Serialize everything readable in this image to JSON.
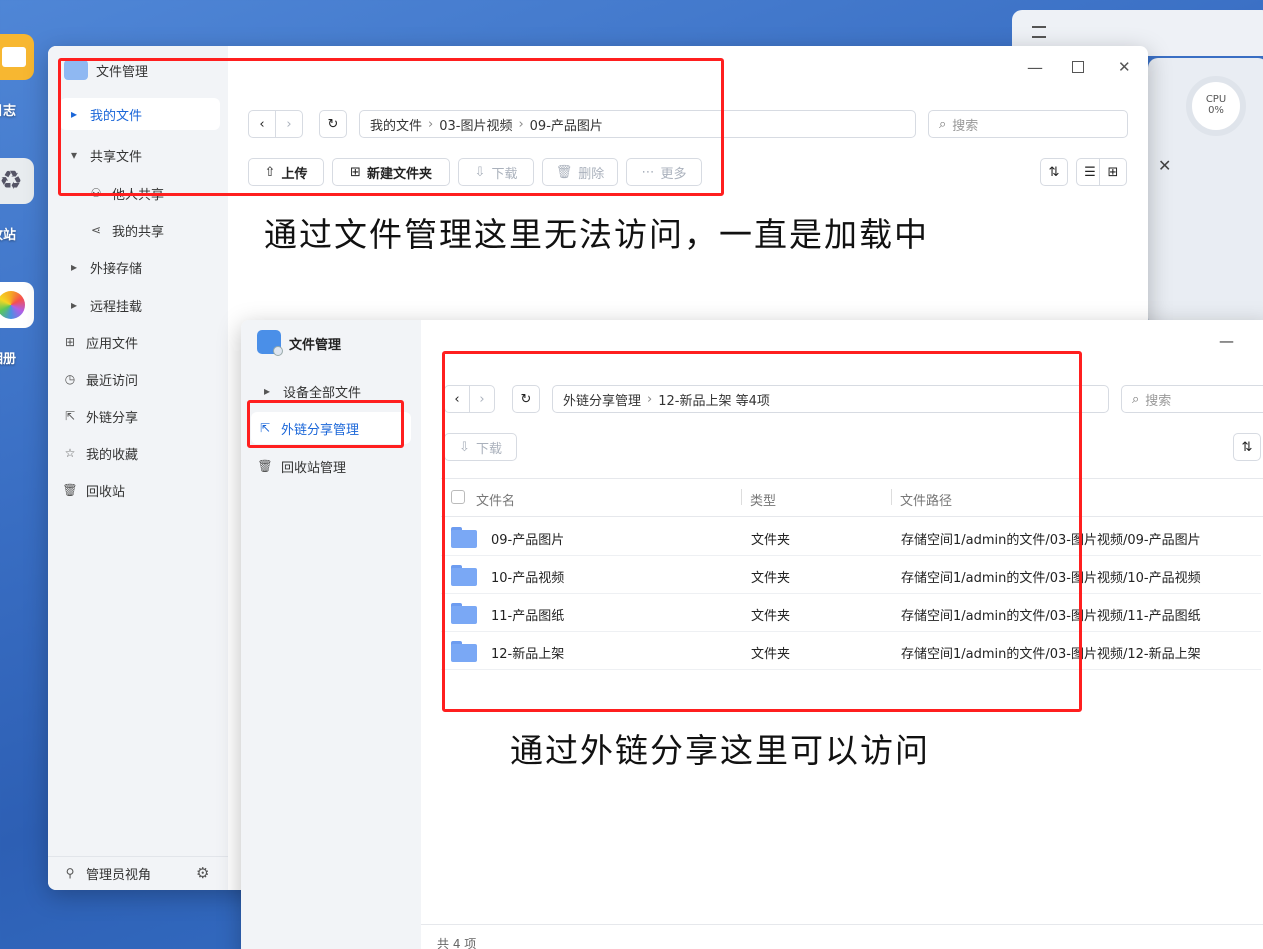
{
  "desktop": {
    "icons": [
      {
        "label": "日志",
        "icon": "log-icon"
      },
      {
        "label": "收站",
        "icon": "recycle-icon"
      },
      {
        "label": "相册",
        "icon": "photos-icon"
      }
    ],
    "widget": {
      "cpu_label": "CPU",
      "cpu_value": "0%"
    }
  },
  "back_window": {
    "title": "文件管理",
    "sidebar": {
      "items": [
        {
          "label": "我的文件",
          "icon": "triangle-right-icon"
        },
        {
          "label": "共享文件",
          "icon": "triangle-down-icon"
        },
        {
          "label": "他人共享",
          "icon": "users-icon"
        },
        {
          "label": "我的共享",
          "icon": "share-icon"
        },
        {
          "label": "外接存储",
          "icon": "triangle-right-icon"
        },
        {
          "label": "远程挂载",
          "icon": "triangle-right-icon"
        },
        {
          "label": "应用文件",
          "icon": "grid-icon"
        },
        {
          "label": "最近访问",
          "icon": "clock-icon"
        },
        {
          "label": "外链分享",
          "icon": "external-share-icon"
        },
        {
          "label": "我的收藏",
          "icon": "star-icon"
        },
        {
          "label": "回收站",
          "icon": "trash-icon"
        }
      ],
      "footer_label": "管理员视角"
    },
    "breadcrumb": [
      "我的文件",
      "03-图片视频",
      "09-产品图片"
    ],
    "search_placeholder": "搜索",
    "toolbar": {
      "upload": "上传",
      "new_folder": "新建文件夹",
      "download": "下载",
      "delete": "删除",
      "more": "更多"
    }
  },
  "front_window": {
    "title": "文件管理",
    "sidebar": {
      "items": [
        {
          "label": "设备全部文件",
          "icon": "triangle-right-icon"
        },
        {
          "label": "外链分享管理",
          "icon": "external-share-icon"
        },
        {
          "label": "回收站管理",
          "icon": "trash-icon"
        }
      ]
    },
    "breadcrumb": [
      "外链分享管理",
      "12-新品上架 等4项"
    ],
    "search_placeholder": "搜索",
    "toolbar": {
      "download": "下载"
    },
    "table": {
      "columns": [
        "文件名",
        "类型",
        "文件路径"
      ],
      "rows": [
        {
          "name": "09-产品图片",
          "type": "文件夹",
          "path": "存储空间1/admin的文件/03-图片视频/09-产品图片"
        },
        {
          "name": "10-产品视频",
          "type": "文件夹",
          "path": "存储空间1/admin的文件/03-图片视频/10-产品视频"
        },
        {
          "name": "11-产品图纸",
          "type": "文件夹",
          "path": "存储空间1/admin的文件/03-图片视频/11-产品图纸"
        },
        {
          "name": "12-新品上架",
          "type": "文件夹",
          "path": "存储空间1/admin的文件/03-图片视频/12-新品上架"
        }
      ]
    },
    "footer_count": "共 4 项"
  },
  "annotations": {
    "top": "通过文件管理这里无法访问，一直是加载中",
    "bottom": "通过外链分享这里可以访问"
  },
  "colors": {
    "accent": "#1a66d8",
    "annotation_box": "#ff1f1f",
    "folder": "#7aa8f5"
  }
}
